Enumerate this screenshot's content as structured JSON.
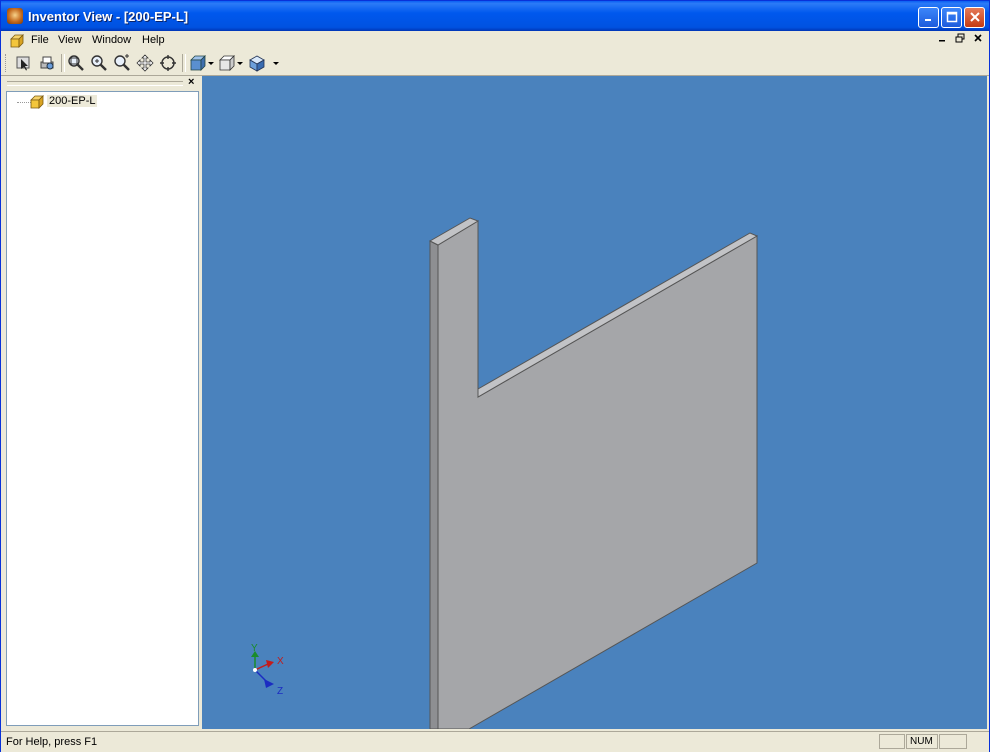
{
  "window": {
    "title": "Inventor View - [200-EP-L]"
  },
  "menu": {
    "items": [
      "File",
      "View",
      "Window",
      "Help"
    ]
  },
  "toolbar": {
    "tools": [
      "select-icon",
      "print-icon",
      "zoom-all-icon",
      "zoom-icon",
      "zoom-window-icon",
      "pan-icon",
      "orbit-icon",
      "view-cube-icon",
      "display-mode-icon",
      "shading-icon"
    ]
  },
  "browser": {
    "root_item": "200-EP-L"
  },
  "axes": {
    "x": "X",
    "y": "Y",
    "z": "Z"
  },
  "status": {
    "help": "For Help, press F1",
    "num": "NUM"
  },
  "colors": {
    "viewport_bg": "#4A82BD",
    "part_face": "#A5A6A9",
    "title_blue": "#0054E3"
  }
}
